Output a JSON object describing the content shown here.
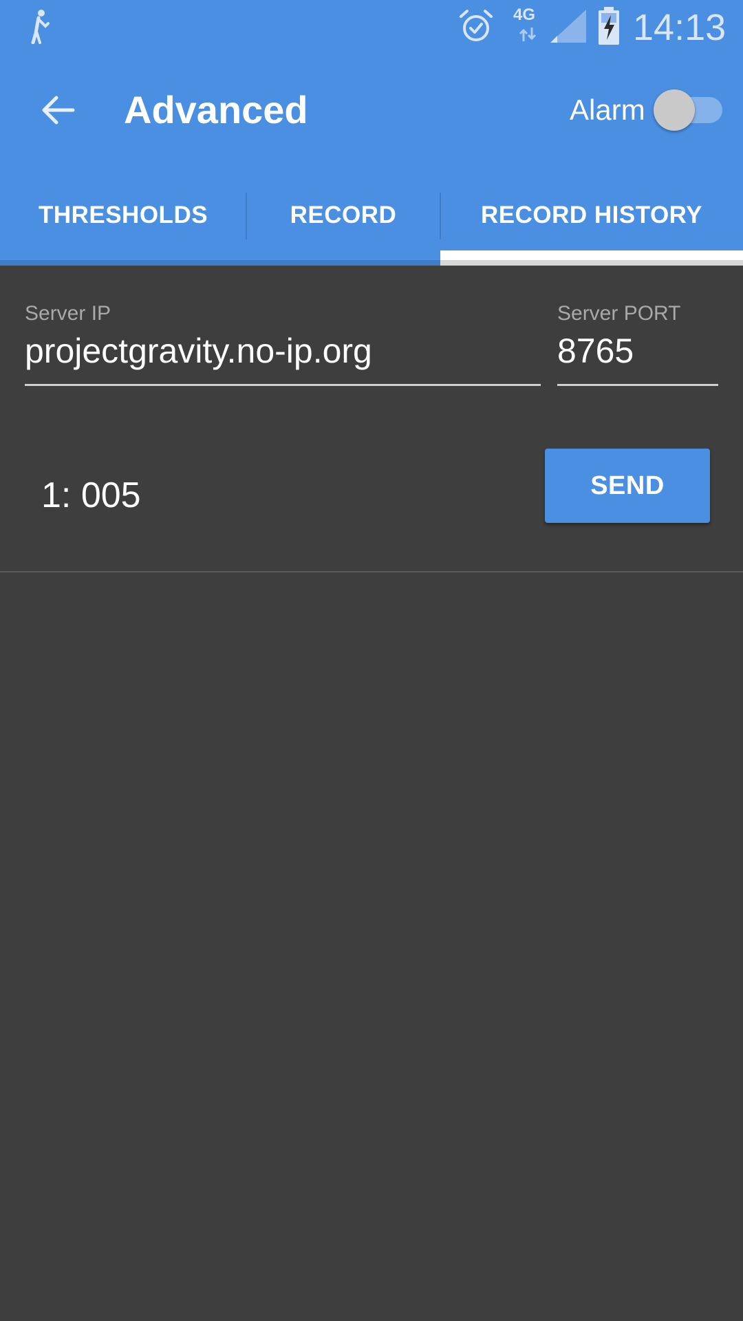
{
  "status_bar": {
    "time": "14:13",
    "network_type": "4G",
    "icons": [
      "walking-person-icon",
      "alarm-clock-icon",
      "data-arrows-icon",
      "signal-icon",
      "battery-charging-icon"
    ]
  },
  "toolbar": {
    "title": "Advanced",
    "back_icon": "arrow-left-icon",
    "alarm_label": "Alarm",
    "alarm_switch_on": false
  },
  "tabs": [
    {
      "label": "THRESHOLDS",
      "active": false
    },
    {
      "label": "RECORD",
      "active": false
    },
    {
      "label": "RECORD HISTORY",
      "active": true
    }
  ],
  "server": {
    "ip_label": "Server IP",
    "ip_value": "projectgravity.no-ip.org",
    "port_label": "Server PORT",
    "port_value": "8765"
  },
  "records": [
    {
      "label": "1: 005",
      "button_label": "SEND"
    }
  ],
  "colors": {
    "primary": "#4a8fe2",
    "background": "#3e3e3e",
    "switch_thumb": "#c9c9c9",
    "switch_track": "#86b2ec"
  }
}
